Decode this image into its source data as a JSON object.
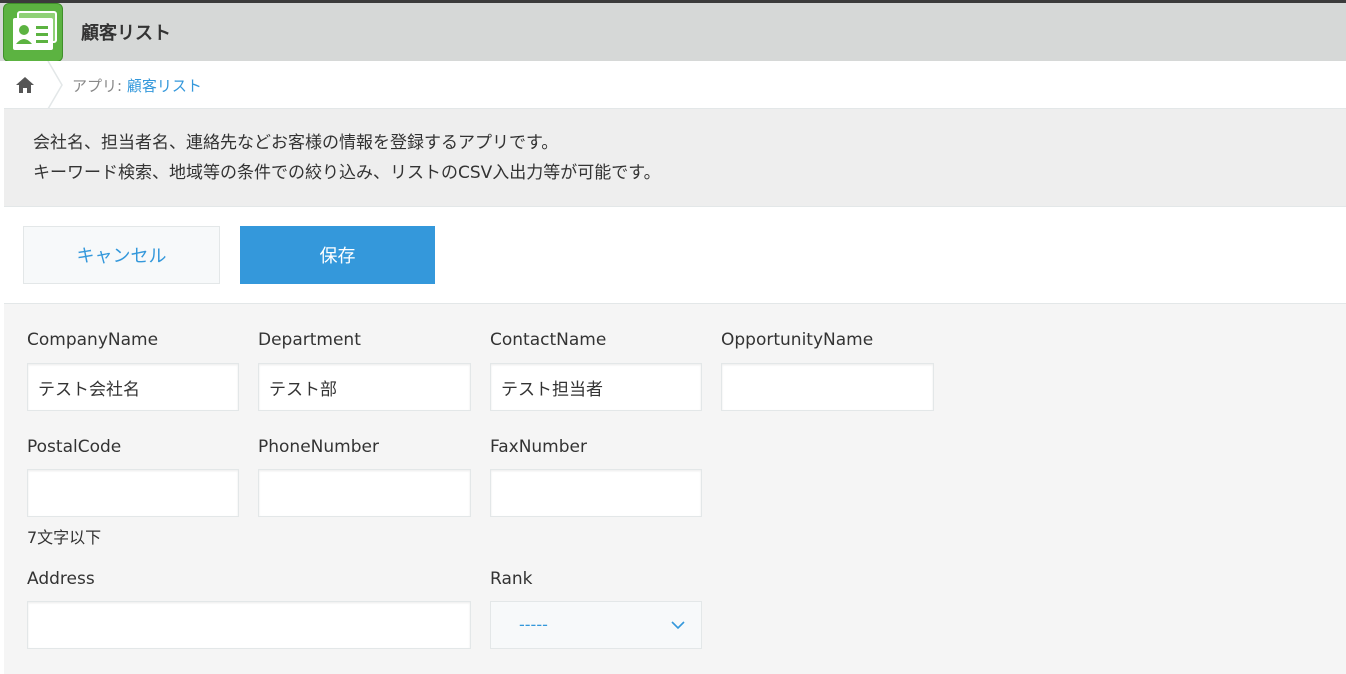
{
  "app": {
    "title": "顧客リスト",
    "icon": "customer-card-icon"
  },
  "breadcrumb": {
    "home_icon": "home-icon",
    "prefix": "アプリ: ",
    "app_link": "顧客リスト"
  },
  "description": {
    "line1": "会社名、担当者名、連絡先などお客様の情報を登録するアプリです。",
    "line2": "キーワード検索、地域等の条件での絞り込み、リストのCSV入出力等が可能です。"
  },
  "toolbar": {
    "cancel_label": "キャンセル",
    "save_label": "保存"
  },
  "form": {
    "company_name": {
      "label": "CompanyName",
      "value": "テスト会社名"
    },
    "department": {
      "label": "Department",
      "value": "テスト部"
    },
    "contact_name": {
      "label": "ContactName",
      "value": "テスト担当者"
    },
    "opportunity_name": {
      "label": "OpportunityName",
      "value": ""
    },
    "postal_code": {
      "label": "PostalCode",
      "value": "",
      "note": "7文字以下"
    },
    "phone_number": {
      "label": "PhoneNumber",
      "value": ""
    },
    "fax_number": {
      "label": "FaxNumber",
      "value": ""
    },
    "address": {
      "label": "Address",
      "value": ""
    },
    "rank": {
      "label": "Rank",
      "selected": "-----"
    }
  },
  "colors": {
    "accent": "#3498db",
    "header_bg": "#d6d8d7",
    "app_icon_green": "#5cb341"
  }
}
